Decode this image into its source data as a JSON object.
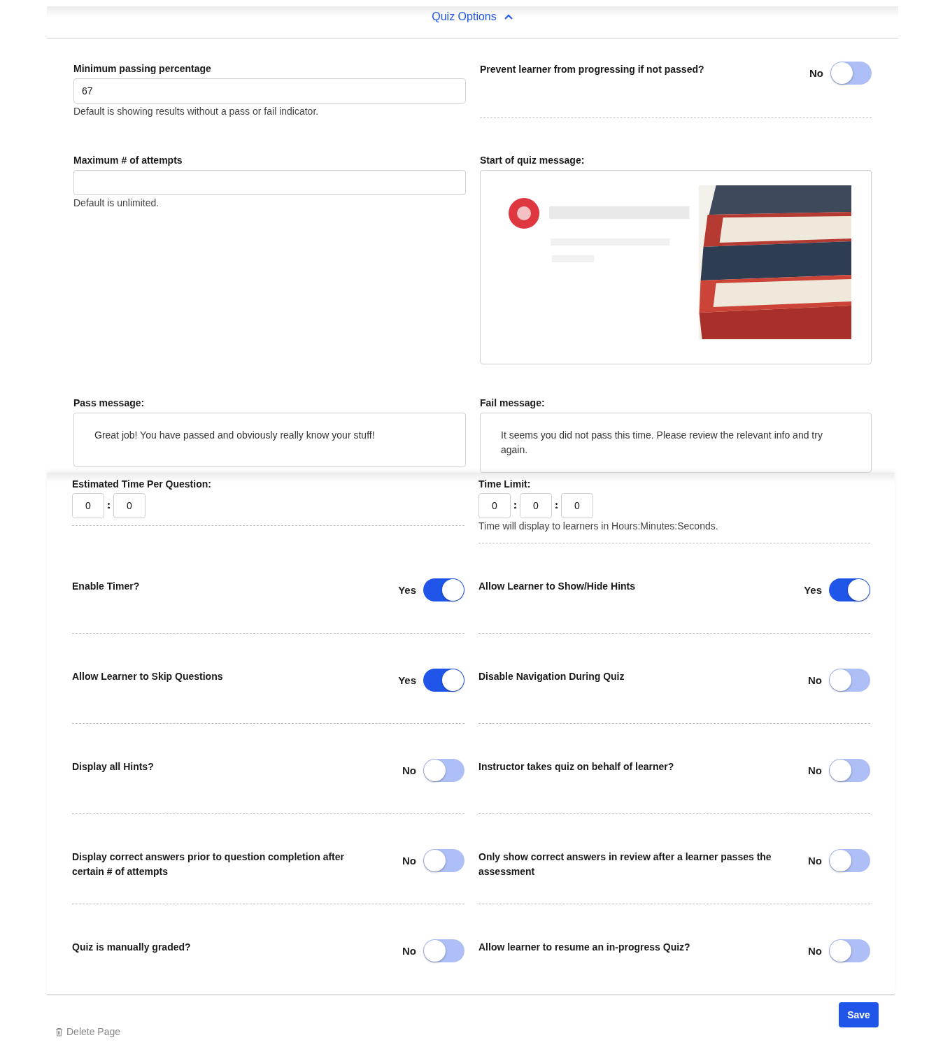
{
  "header": {
    "title": "Quiz Options",
    "expanded": true
  },
  "min_passing": {
    "label": "Minimum passing percentage",
    "value": "67",
    "help": "Default is showing results without a pass or fail indicator."
  },
  "prevent_progress": {
    "label": "Prevent learner from progressing if not passed?",
    "state_label": "No",
    "on": false
  },
  "max_attempts": {
    "label": "Maximum # of attempts",
    "help": "Default is unlimited."
  },
  "start_message": {
    "label": "Start of quiz message:",
    "kind": "picture"
  },
  "pass_message": {
    "label": "Pass message:",
    "text": "Great job! You have passed and obviously really know your stuff!"
  },
  "fail_message": {
    "label": "Fail message:",
    "text": "It seems you did not pass this time. Please review the relevant info and try again."
  },
  "estimated_time": {
    "label": "Estimated Time Per Question:",
    "parts": [
      "0",
      "0"
    ]
  },
  "time_limit": {
    "label": "Time Limit:",
    "parts": [
      "0",
      "0",
      "0"
    ],
    "help": "Time will display to learners in Hours:Minutes:Seconds."
  },
  "toggles": [
    {
      "label": "Enable Timer?",
      "state_label": "Yes",
      "on": true
    },
    {
      "label": "Allow Learner to Show/Hide Hints",
      "state_label": "Yes",
      "on": true
    },
    {
      "label": "Allow Learner to Skip Questions",
      "state_label": "Yes",
      "on": true
    },
    {
      "label": "Disable Navigation During Quiz",
      "state_label": "No",
      "on": false
    },
    {
      "label": "Display all Hints?",
      "state_label": "No",
      "on": false
    },
    {
      "label": "Instructor takes quiz on behalf of learner?",
      "state_label": "No",
      "on": false
    },
    {
      "label": "Display correct answers prior to question completion after certain # of attempts",
      "state_label": "No",
      "on": false
    },
    {
      "label": "Only show correct answers in review after a learner passes the assessment",
      "state_label": "No",
      "on": false
    },
    {
      "label": "Quiz is manually graded?",
      "state_label": "No",
      "on": false
    },
    {
      "label": "Allow learner to resume an in-progress Quiz?",
      "state_label": "No",
      "on": false
    }
  ],
  "footer": {
    "delete": "Delete Page",
    "save": "Save"
  }
}
